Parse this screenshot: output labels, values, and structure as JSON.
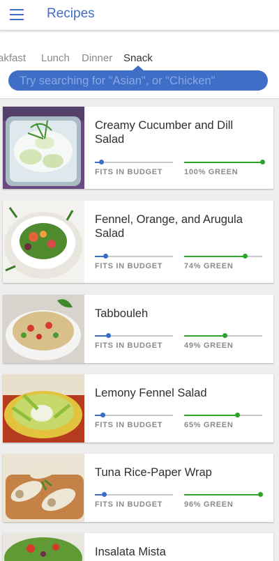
{
  "header": {
    "title": "Recipes"
  },
  "tabs": [
    "akfast",
    "Lunch",
    "Dinner",
    "Snack"
  ],
  "active_tab": "Snack",
  "search": {
    "placeholder": "Try searching for \"Asian\", or \"Chicken\""
  },
  "colors": {
    "accent": "#3f6ec6",
    "budget": "#3a6cc8",
    "green": "#2aa52a"
  },
  "recipes": [
    {
      "title": "Creamy Cucumber and Dill Salad",
      "budget_label": "FITS IN BUDGET",
      "budget_level": 0.08,
      "green_label": "100% GREEN",
      "green_percent": 100,
      "image": "cucumber-dill-salad"
    },
    {
      "title": "Fennel, Orange, and Arugula Salad",
      "budget_label": "FITS IN BUDGET",
      "budget_level": 0.13,
      "green_label": "74% GREEN",
      "green_percent": 78,
      "image": "fennel-orange-salad"
    },
    {
      "title": "Tabbouleh",
      "budget_label": "FITS IN BUDGET",
      "budget_level": 0.17,
      "green_label": "49% GREEN",
      "green_percent": 52,
      "image": "tabbouleh"
    },
    {
      "title": "Lemony Fennel Salad",
      "budget_label": "FITS IN BUDGET",
      "budget_level": 0.1,
      "green_label": "65% GREEN",
      "green_percent": 68,
      "image": "lemony-fennel-salad"
    },
    {
      "title": "Tuna Rice-Paper Wrap",
      "budget_label": "FITS IN BUDGET",
      "budget_level": 0.12,
      "green_label": "96% GREEN",
      "green_percent": 97,
      "image": "tuna-wrap"
    },
    {
      "title": "Insalata Mista",
      "budget_label": "",
      "budget_level": null,
      "green_label": "",
      "green_percent": null,
      "image": "insalata-mista"
    }
  ]
}
